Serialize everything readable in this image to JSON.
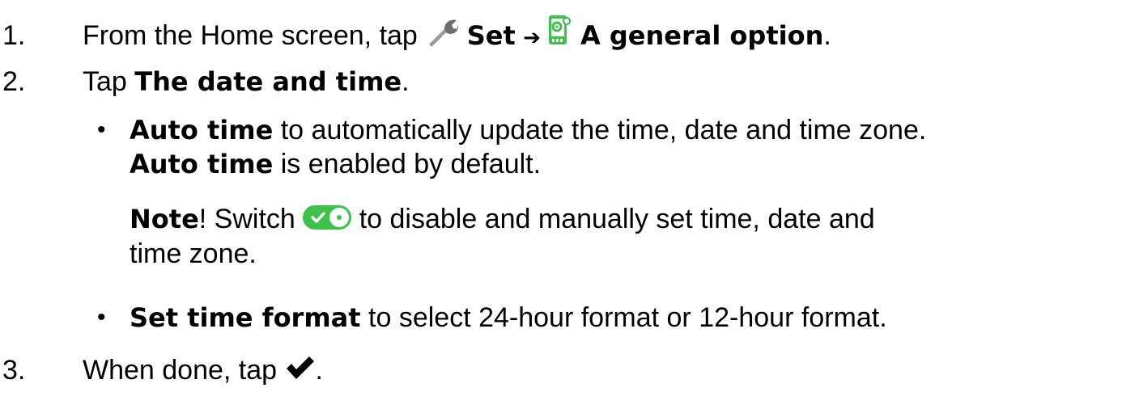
{
  "steps": [
    {
      "number": "1.",
      "text_before": "From the Home screen, tap",
      "settings_label": "Set",
      "arrow": "➔",
      "general_label": "A general option",
      "end_punct": ".",
      "icons": [
        "wrench-icon",
        "general-settings-icon"
      ]
    },
    {
      "number": "2.",
      "text_before": "Tap",
      "label": "The date and time",
      "end_punct": ".",
      "bullets": [
        {
          "symbol": "•",
          "bold": "Auto time",
          "text": "to automatically update the time, date and time zone.",
          "line2_bold": "Auto time",
          "line2_text": "is enabled by default.",
          "note": {
            "bold": "Note",
            "mark": "!",
            "text_before": "Switch",
            "text_after": "to disable and manually set time, date and",
            "text_line2": "time zone",
            "end_punct": ".",
            "icon": "toggle-on-icon"
          }
        },
        {
          "symbol": "•",
          "bold": "Set time format",
          "text": "to select 24-hour format or 12-hour format."
        }
      ]
    },
    {
      "number": "3.",
      "text_before": "When done, tap",
      "end_punct": ".",
      "icon": "checkmark-icon"
    }
  ],
  "colors": {
    "text": "#000000",
    "accent_green": "#3ec14a",
    "icon_gray": "#888888"
  }
}
